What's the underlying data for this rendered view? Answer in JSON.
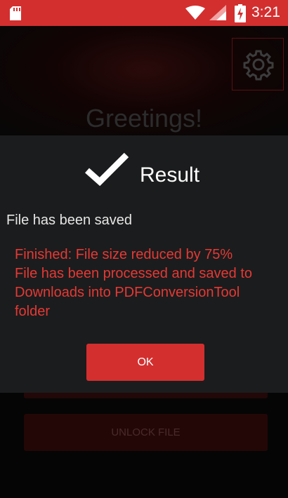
{
  "status_bar": {
    "time": "3:21",
    "icons": [
      "sd-card-icon",
      "wifi-icon",
      "signal-icon",
      "battery-charging-icon"
    ],
    "color": "#d32f2f"
  },
  "background": {
    "greeting": "Greetings!",
    "unlock_button_label": "UNLOCK FILE",
    "icons": [
      "gear-icon"
    ]
  },
  "dialog": {
    "title": "Result",
    "icon": "checkmark-icon",
    "message": "File has been saved",
    "detail_lines": [
      "Finished: File size reduced by 75%",
      "File has been processed and saved to",
      "Downloads into PDFConversionTool",
      "folder"
    ],
    "ok_label": "OK",
    "accent_color": "#d32f2f",
    "detail_color": "#e53935"
  }
}
